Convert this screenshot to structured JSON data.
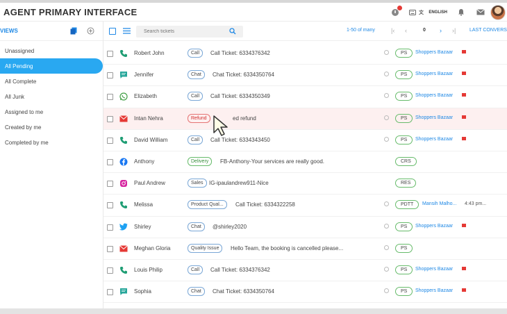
{
  "app": {
    "title": "AGENT PRIMARY INTERFACE",
    "language": "ENGLISH"
  },
  "sidebar": {
    "title": "VIEWS",
    "items": [
      {
        "label": "Unassigned",
        "active": false
      },
      {
        "label": "All Pending",
        "active": true
      },
      {
        "label": "All Complete",
        "active": false
      },
      {
        "label": "All Junk",
        "active": false
      },
      {
        "label": "Assigned to me",
        "active": false
      },
      {
        "label": "Created by me",
        "active": false
      },
      {
        "label": "Completed by me",
        "active": false
      }
    ]
  },
  "toolbar": {
    "search_placeholder": "Search tickets",
    "pager_text": "1-50 of many",
    "page_number": "0",
    "last_conversation_label": "LAST CONVERS"
  },
  "colors": {
    "accent": "#1e88e5",
    "active_sidebar": "#29a8f1",
    "flag": "#e53935",
    "highlight_row": "#fdf0f0"
  },
  "tickets": [
    {
      "name": "Robert John",
      "channel": "call",
      "tag": "Call",
      "tag_style": "blue",
      "subject": "Call Ticket: 6334376342",
      "team": "PS",
      "company": "Shoppers Bazaar",
      "flag": true,
      "time": ""
    },
    {
      "name": "Jennifer",
      "channel": "chat",
      "tag": "Chat",
      "tag_style": "blue",
      "subject": "Chat Ticket: 6334350764",
      "team": "PS",
      "company": "Shoppers Bazaar",
      "flag": true,
      "time": ""
    },
    {
      "name": "Elizabeth",
      "channel": "whatsapp",
      "tag": "Call",
      "tag_style": "blue",
      "subject": "Call Ticket: 6334350349",
      "team": "PS",
      "company": "Shoppers Bazaar",
      "flag": true,
      "time": ""
    },
    {
      "name": "Intan Nehra",
      "channel": "email",
      "tag": "Refund",
      "tag_style": "red",
      "subject": "ed refund",
      "team": "PS",
      "company": "Shoppers Bazaar",
      "flag": true,
      "time": "",
      "highlight": true
    },
    {
      "name": "David William",
      "channel": "call",
      "tag": "Call",
      "tag_style": "blue",
      "subject": "Call Ticket: 6334343450",
      "team": "PS",
      "company": "Shoppers Bazaar",
      "flag": true,
      "time": ""
    },
    {
      "name": "Anthony",
      "channel": "facebook",
      "tag": "Delivery",
      "tag_style": "green",
      "subject": "FB-Anthony-Your services are really good.",
      "team": "CRS",
      "company": "",
      "flag": false,
      "time": ""
    },
    {
      "name": "Paul Andrew",
      "channel": "instagram",
      "tag": "Sales",
      "tag_style": "blue",
      "subject": "IG-ipaulandrew911-Nice",
      "team": "RES",
      "company": "",
      "flag": false,
      "time": ""
    },
    {
      "name": "Melissa",
      "channel": "call",
      "tag": "Product Qual...",
      "tag_style": "blue",
      "subject": "Call Ticket: 6334322258",
      "team": "PDTT",
      "company": "Mansih Malho...",
      "flag": false,
      "time": "4:43 pm..."
    },
    {
      "name": "Shirley",
      "channel": "twitter",
      "tag": "Chat",
      "tag_style": "blue",
      "subject": "@shirley2020",
      "team": "PS",
      "company": "Shoppers Bazaar",
      "flag": true,
      "time": ""
    },
    {
      "name": "Meghan Gloria",
      "channel": "email",
      "tag": "Quality Issue",
      "tag_style": "blue",
      "subject": "Hello Team, the booking is cancelled please...",
      "team": "PS",
      "company": "",
      "flag": false,
      "time": ""
    },
    {
      "name": "Louis Philip",
      "channel": "call",
      "tag": "Call",
      "tag_style": "blue",
      "subject": "Call Ticket: 6334376342",
      "team": "PS",
      "company": "Shoppers Bazaar",
      "flag": true,
      "time": ""
    },
    {
      "name": "Sophia",
      "channel": "chat",
      "tag": "Chat",
      "tag_style": "blue",
      "subject": "Chat Ticket: 6334350764",
      "team": "PS",
      "company": "Shoppers Bazaar",
      "flag": true,
      "time": ""
    }
  ]
}
